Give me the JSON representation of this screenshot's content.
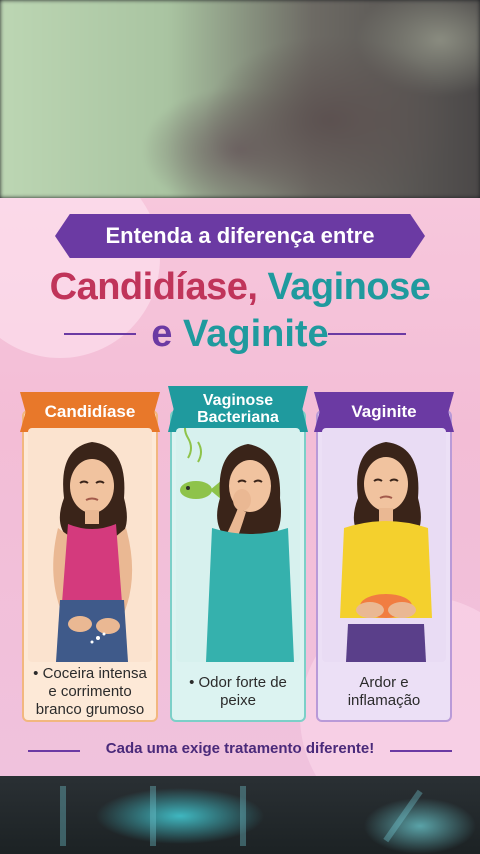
{
  "poster": {
    "header_banner": "Entenda a diferença entre",
    "title_line1_part1": "Candidíase,",
    "title_line1_part2": " Vaginose",
    "title_line2_part1": "e",
    "title_line2_part2": " Vaginite",
    "cards": [
      {
        "label": "Candidíase",
        "caption": "• Coceira intensa e corrimento branco grumoso",
        "accent": "#e8782a"
      },
      {
        "label": "Vaginose Bacteriana",
        "caption": "• Odor forte de peixe",
        "accent": "#1f9a9e"
      },
      {
        "label": "Vaginite",
        "caption": "Ardor e inflamação",
        "accent": "#6b3aa3"
      }
    ],
    "footer": "Cada uma exige tratamento diferente!"
  },
  "colors": {
    "pink_title": "#c0345a",
    "teal": "#1f9a9e",
    "purple": "#6b3aa3",
    "orange": "#e8782a"
  }
}
